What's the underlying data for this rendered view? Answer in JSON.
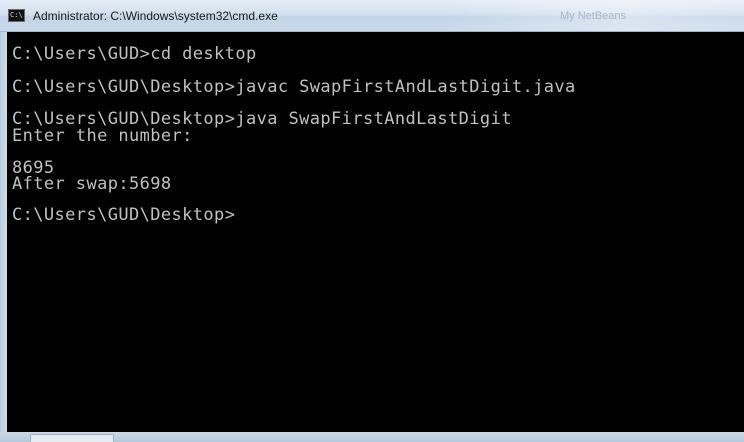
{
  "window": {
    "title": "Administrator: C:\\Windows\\system32\\cmd.exe",
    "background_title_hint": "My NetBeans",
    "icon": "cmd-icon",
    "icon_glyph": "C:\\"
  },
  "console": {
    "text_color": "#c0c0c0",
    "background_color": "#000000",
    "lines": [
      "C:\\Users\\GUD>cd desktop",
      "C:\\Users\\GUD\\Desktop>javac SwapFirstAndLastDigit.java",
      "C:\\Users\\GUD\\Desktop>java SwapFirstAndLastDigit",
      "Enter the number:",
      "8695",
      "After swap:5698",
      "C:\\Users\\GUD\\Desktop>"
    ]
  }
}
